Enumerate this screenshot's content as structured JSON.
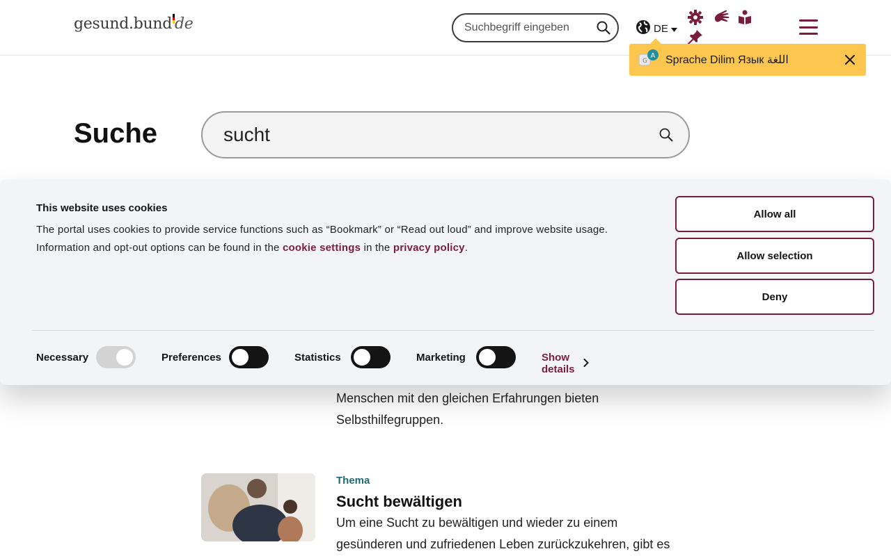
{
  "header": {
    "logo_text": "gesund.bund",
    "logo_suffix": "de",
    "search_placeholder": "Suchbegriff eingeben",
    "language": "DE",
    "brand_color": "#7a1d3d"
  },
  "language_tip": {
    "text": "Sprache Dilim Язык اللغة",
    "bg_color": "#fdc74f"
  },
  "search": {
    "title": "Suche",
    "query": "sucht"
  },
  "results": {
    "partial_text": "Menschen mit den gleichen Erfahrungen bieten Selbsthilfegruppen.",
    "items": [
      {
        "tag": "Thema",
        "title": "Sucht bewältigen",
        "teaser": "Um eine Sucht zu bewältigen und wieder zu einem gesünderen und zufriedenen Leben zurückzukehren, gibt es"
      }
    ]
  },
  "cookie_banner": {
    "heading": "This website uses cookies",
    "text_before_link1": "The portal uses cookies to provide service functions such as “Bookmark” or “Read out loud” and improve website usage. Information and opt-out options can be found in the ",
    "link1": "cookie settings",
    "text_between": " in the ",
    "link2": "privacy policy",
    "text_after": ".",
    "buttons": {
      "allow_all": "Allow all",
      "allow_selection": "Allow selection",
      "deny": "Deny"
    },
    "toggles": [
      {
        "label": "Necessary",
        "state": "on-disabled"
      },
      {
        "label": "Preferences",
        "state": "off"
      },
      {
        "label": "Statistics",
        "state": "off"
      },
      {
        "label": "Marketing",
        "state": "off"
      }
    ],
    "show_details": "Show details"
  }
}
